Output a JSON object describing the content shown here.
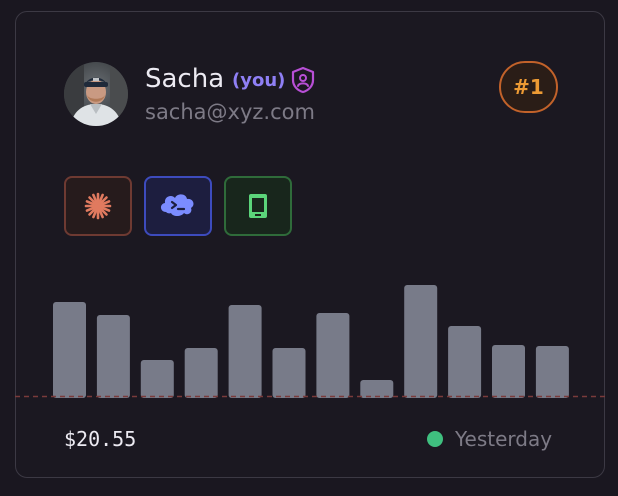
{
  "user": {
    "name": "Sacha",
    "you_tag": "(you)",
    "email": "sacha@xyz.com",
    "avatar": "avatar-photo",
    "role_icon": "shield-user-icon"
  },
  "rank": {
    "label": "#1"
  },
  "tools": [
    {
      "name": "claude-icon",
      "accent": "#e07a5f"
    },
    {
      "name": "terminal-cloud-icon",
      "accent": "#7b8cff"
    },
    {
      "name": "phone-icon",
      "accent": "#5bd47a"
    }
  ],
  "chart_data": {
    "type": "bar",
    "values": [
      94,
      81,
      36,
      48,
      91,
      48,
      83,
      16,
      111,
      70,
      51,
      50
    ],
    "ylim": [
      0,
      120
    ],
    "grid": false,
    "bar_color": "#787b89",
    "baseline_color": "#7a3b3b"
  },
  "footer": {
    "price": "$20.55",
    "status": "Yesterday",
    "status_color": "#3fbf7f"
  }
}
